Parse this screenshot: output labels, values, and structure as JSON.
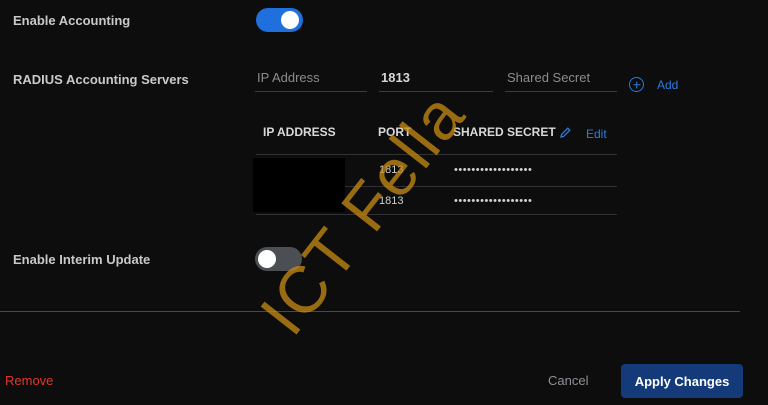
{
  "accounting": {
    "label": "Enable Accounting",
    "enabled": true
  },
  "servers": {
    "label": "RADIUS Accounting Servers",
    "ip_placeholder": "IP Address",
    "port_value": "1813",
    "secret_placeholder": "Shared Secret",
    "add_label": "Add",
    "columns": {
      "ip": "IP ADDRESS",
      "port": "PORT",
      "secret": "SHARED SECRET"
    },
    "edit_label": "Edit",
    "rows": [
      {
        "port": "1813",
        "secret": "••••••••••••••••••"
      },
      {
        "port": "1813",
        "secret": "••••••••••••••••••"
      }
    ]
  },
  "interim": {
    "label": "Enable Interim Update",
    "enabled": false
  },
  "footer": {
    "remove_label": "Remove",
    "cancel_label": "Cancel",
    "apply_label": "Apply Changes"
  },
  "watermark": "ICT Fella",
  "colors": {
    "accent": "#1f6fdc",
    "danger": "#e0362d",
    "primary_button": "#153a7a"
  }
}
